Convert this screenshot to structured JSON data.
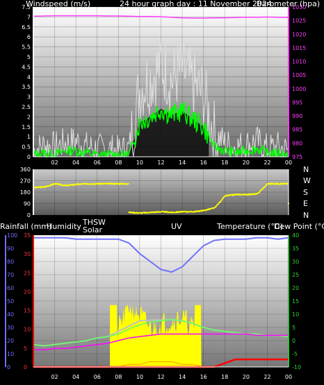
{
  "top": {
    "title_left": "Windspeed (m/s)",
    "title_center": "24 hour graph day : 11 November 2024",
    "title_right": "Barometer (hpa)",
    "y_left_ticks": [
      "7.5",
      "7",
      "6.5",
      "6",
      "5.5",
      "5",
      "4.5",
      "4",
      "3.5",
      "3",
      "2.5",
      "2",
      "1.5",
      "1",
      "0.5",
      "0"
    ],
    "y_right_ticks": [
      "1030",
      "1025",
      "1020",
      "1015",
      "1010",
      "1005",
      "1000",
      "995",
      "990",
      "985",
      "980",
      "975"
    ],
    "x_ticks": [
      "02",
      "04",
      "06",
      "08",
      "10",
      "12",
      "14",
      "16",
      "18",
      "20",
      "22",
      "00"
    ],
    "colors": {
      "wind_gust": "#e0e0e0",
      "wind_avg": "#00ff00",
      "barometer": "#ff40ff",
      "axis_left": "#ffffff",
      "axis_right": "#ff40ff"
    }
  },
  "mid": {
    "y_ticks": [
      "360",
      "270",
      "180",
      "90",
      "0"
    ],
    "direction_labels": [
      "N",
      "W",
      "S",
      "E",
      "N"
    ],
    "colors": {
      "direction": "#ffff00"
    }
  },
  "bottom": {
    "legend": {
      "rainfall": "Rainfall (mm)",
      "humidity": "Humidity",
      "thsw": "THSW",
      "solar": "Solar",
      "uv": "UV",
      "temperature": "Temperature (°C)",
      "dew_point": "Dew Point (°C)"
    },
    "y_humidity_ticks": [
      "100",
      "90",
      "80",
      "70",
      "60",
      "50",
      "40",
      "30",
      "20",
      "10",
      "0"
    ],
    "y_rain_ticks": [
      "35",
      "30",
      "25",
      "20",
      "15",
      "10",
      "5",
      "0"
    ],
    "y_temp_ticks": [
      "40",
      "35",
      "30",
      "25",
      "20",
      "15",
      "10",
      "5",
      "0",
      "-5",
      "-10"
    ],
    "x_ticks": [
      "02",
      "04",
      "06",
      "08",
      "10",
      "12",
      "14",
      "16",
      "18",
      "20",
      "22",
      "00"
    ],
    "colors": {
      "humidity": "#7070ff",
      "solar": "#ffff00",
      "thsw": "#c0c0c0",
      "uv": "#ff9900",
      "temperature": "#60ff60",
      "dew_point": "#ff00ff",
      "rainfall": "#ff0000"
    }
  },
  "chart_data": [
    {
      "type": "line",
      "title": "24 hour graph day : 11 November 2024",
      "x": [
        0,
        1,
        2,
        3,
        4,
        5,
        6,
        7,
        8,
        9,
        10,
        11,
        12,
        13,
        14,
        15,
        16,
        17,
        18,
        19,
        20,
        21,
        22,
        23,
        24
      ],
      "series": [
        {
          "name": "Windspeed (m/s)",
          "axis": "left",
          "values": [
            0.3,
            0.6,
            0.5,
            0.7,
            0.8,
            0.5,
            0.4,
            0.4,
            0.3,
            0.4,
            3.4,
            3.9,
            4.6,
            3.8,
            4.4,
            3.6,
            3.1,
            1.2,
            0.7,
            0.5,
            0.6,
            0.8,
            0.4,
            0.5,
            0.3
          ]
        },
        {
          "axis": "left",
          "values": [
            0.1,
            0.2,
            0.1,
            0.3,
            0.3,
            0.2,
            0.1,
            0.1,
            0.1,
            0.1,
            1.7,
            2.0,
            2.4,
            2.1,
            2.3,
            1.9,
            1.5,
            0.5,
            0.3,
            0.2,
            0.3,
            0.4,
            0.2,
            0.2,
            0.1
          ]
        },
        {
          "name": "Barometer (hpa)",
          "axis": "right",
          "values": [
            1026.6,
            1026.7,
            1026.8,
            1026.8,
            1026.8,
            1026.8,
            1026.8,
            1026.7,
            1026.7,
            1026.6,
            1026.5,
            1026.5,
            1026.4,
            1026.2,
            1026.0,
            1025.9,
            1025.9,
            1026.0,
            1026.0,
            1026.1,
            1026.2,
            1026.2,
            1026.3,
            1026.2,
            1026.1
          ]
        }
      ],
      "xlim": [
        0,
        24
      ],
      "ylim_left": [
        0,
        7.5
      ],
      "ylim_right": [
        975,
        1030
      ]
    },
    {
      "type": "scatter",
      "series": [
        {
          "values": [
            [
              0,
              215
            ],
            [
              1,
              220
            ],
            [
              2,
              245
            ],
            [
              3,
              230
            ],
            [
              4,
              240
            ],
            [
              5,
              245
            ],
            [
              6,
              245
            ],
            [
              7,
              245
            ],
            [
              8,
              245
            ],
            [
              9,
              20
            ],
            [
              10,
              15
            ],
            [
              11,
              20
            ],
            [
              12,
              25
            ],
            [
              13,
              20
            ],
            [
              14,
              25
            ],
            [
              15,
              25
            ],
            [
              16,
              35
            ],
            [
              17,
              55
            ],
            [
              18,
              150
            ],
            [
              19,
              160
            ],
            [
              20,
              160
            ],
            [
              21,
              165
            ],
            [
              22,
              245
            ],
            [
              23,
              245
            ],
            [
              24,
              90
            ]
          ]
        }
      ],
      "xlim": [
        0,
        24
      ],
      "ylim": [
        0,
        360
      ]
    },
    {
      "type": "area",
      "x": [
        0,
        1,
        2,
        3,
        4,
        5,
        6,
        7,
        8,
        9,
        10,
        11,
        12,
        13,
        14,
        15,
        16,
        17,
        18,
        19,
        20,
        21,
        22,
        23,
        24
      ],
      "series": [
        {
          "name": "Humidity",
          "axis": "humidity",
          "values": [
            98,
            98,
            98,
            98,
            97,
            97,
            97,
            97,
            97,
            94,
            86,
            80,
            74,
            72,
            76,
            84,
            92,
            96,
            97,
            97,
            97,
            98,
            98,
            97,
            98
          ]
        },
        {
          "name": "Solar",
          "axis": "humidity",
          "values": [
            0,
            0,
            0,
            0,
            0,
            0,
            0,
            0,
            30,
            47,
            40,
            30,
            33,
            35,
            38,
            30,
            0,
            0,
            0,
            0,
            0,
            0,
            0,
            0,
            0
          ]
        },
        {
          "name": "THSW",
          "axis": "temperature",
          "values": [
            -1.5,
            -2,
            -1.5,
            -1,
            -0.5,
            0,
            1,
            1.5,
            3.5,
            5.5,
            7.5,
            7.8,
            7.8,
            8,
            7.5,
            6.5,
            5,
            4,
            3.5,
            3,
            2.5,
            2.5,
            2,
            2,
            1.5
          ]
        },
        {
          "name": "UV",
          "axis": "humidity",
          "values": [
            0,
            0,
            0,
            0,
            0,
            0,
            0,
            0,
            0,
            0.5,
            0.5,
            1,
            1,
            1,
            0.5,
            0.5,
            0,
            0,
            0,
            0,
            0,
            0,
            0,
            0,
            0
          ]
        },
        {
          "name": "Temperature (°C)",
          "axis": "temperature",
          "values": [
            -1.5,
            -2,
            -1.5,
            -1,
            -0.5,
            0,
            1,
            1.5,
            2.5,
            4.5,
            6,
            7,
            7.5,
            8,
            7.5,
            6.5,
            5,
            4,
            3.5,
            3,
            2.5,
            2.5,
            2,
            2,
            1.5
          ]
        },
        {
          "name": "Dew Point (°C)",
          "axis": "temperature",
          "values": [
            -3.5,
            -3.5,
            -3,
            -3,
            -2.5,
            -2,
            -1.5,
            -1,
            0,
            1,
            1.5,
            2,
            2.5,
            2.5,
            2.5,
            2.5,
            2.5,
            2.5,
            2.5,
            2.5,
            2.5,
            2,
            2,
            2,
            2
          ]
        },
        {
          "name": "Rainfall (mm)",
          "axis": "rain",
          "values": [
            0,
            0,
            0,
            0,
            0,
            0,
            0,
            0,
            0,
            0,
            0,
            0,
            0,
            0,
            0,
            0,
            0,
            0,
            1,
            2,
            2,
            2,
            2,
            2,
            2
          ]
        }
      ],
      "xlim": [
        0,
        24
      ],
      "ylim_humidity": [
        0,
        100
      ],
      "ylim_rain": [
        0,
        35
      ],
      "ylim_temperature": [
        -10,
        40
      ]
    }
  ]
}
